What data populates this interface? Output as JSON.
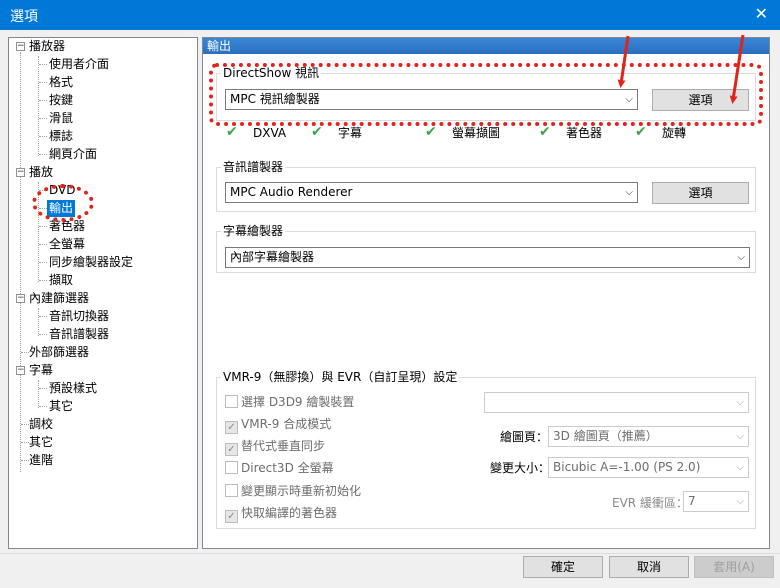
{
  "window": {
    "title": "選項",
    "close_glyph": "✕"
  },
  "tree": {
    "player": "播放器",
    "player_children": [
      "使用者介面",
      "格式",
      "按鍵",
      "滑鼠",
      "標誌",
      "網頁介面"
    ],
    "playback": "播放",
    "playback_children": [
      "DVD",
      "輸出",
      "著色器",
      "全螢幕",
      "同步繪製器設定",
      "擷取"
    ],
    "internal_filters": "內建篩選器",
    "internal_children": [
      "音訊切換器",
      "音訊譜製器"
    ],
    "external_filters": "外部篩選器",
    "subtitles": "字幕",
    "subtitle_children": [
      "預設樣式",
      "其它"
    ],
    "tweaks": "調校",
    "misc": "其它",
    "advanced": "進階",
    "expander_minus": "−"
  },
  "panel": {
    "header": "輸出",
    "directshow": {
      "label": "DirectShow 視訊",
      "value": "MPC 視訊繪製器",
      "options_button": "選項",
      "capabilities": [
        "DXVA",
        "字幕",
        "螢幕擷圖",
        "著色器",
        "旋轉"
      ],
      "check_glyph": "✔"
    },
    "audio": {
      "label": "音訊譜製器",
      "value": "MPC Audio Renderer",
      "options_button": "選項"
    },
    "subtitle": {
      "label": "字幕繪製器",
      "value": "內部字幕繪製器"
    },
    "vmr": {
      "label": "VMR-9（無膠換）與 EVR（自訂呈現）設定",
      "checkboxes": [
        {
          "label": "選擇 D3D9 繪製裝置",
          "checked": false
        },
        {
          "label": "VMR-9 合成模式",
          "checked": true
        },
        {
          "label": "替代式垂直同步",
          "checked": true
        },
        {
          "label": "Direct3D 全螢幕",
          "checked": false
        },
        {
          "label": "變更顯示時重新初始化",
          "checked": false
        },
        {
          "label": "快取編譯的著色器",
          "checked": true
        }
      ],
      "check_mark": "✓",
      "device_value": "",
      "surface_label": "繪圖頁：",
      "surface_value": "3D 繪圖頁（推薦）",
      "resize_label": "變更大小：",
      "resize_value": "Bicubic A=-1.00 (PS 2.0)",
      "evr_label": "EVR 緩衝區：",
      "evr_value": "7"
    }
  },
  "combo_arrow": "⌵",
  "footer": {
    "ok": "確定",
    "cancel": "取消",
    "apply": "套用(A)"
  },
  "annotation_color": "#e0231b"
}
